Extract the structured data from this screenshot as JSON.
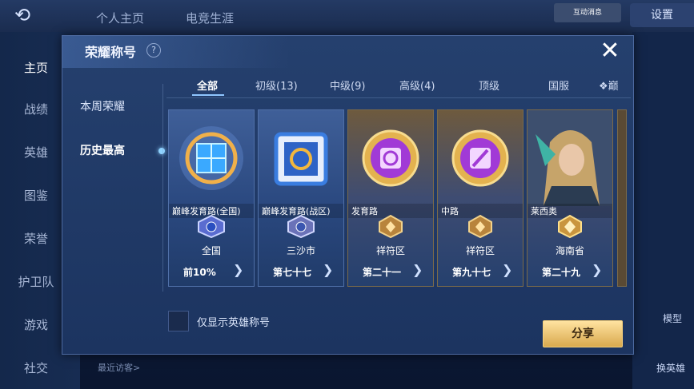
{
  "background": {
    "top_tabs": [
      "个人主页",
      "电竞生涯"
    ],
    "settings_label": "设置",
    "badge_text": "互动消息",
    "nav": [
      "主页",
      "战绩",
      "英雄",
      "图鉴",
      "荣誉",
      "护卫队",
      "游戏",
      "社交"
    ],
    "bottom_text": "最近访客>",
    "right_labels": [
      "模型",
      "换英雄"
    ]
  },
  "dialog": {
    "title": "荣耀称号",
    "help": "?",
    "close": "✕",
    "side_tabs": [
      "本周荣耀",
      "历史最高"
    ],
    "active_side_tab": "历史最高",
    "filter_tabs": [
      "全部",
      "初级(13)",
      "中级(9)",
      "高级(4)",
      "顶级",
      "国服",
      "巅"
    ],
    "active_filter": "全部",
    "cards": [
      {
        "name": "巅峰发育路(全国)",
        "region": "全国",
        "rank": "前10%",
        "art": "blue-cube-emblem-icon",
        "tier": "silver"
      },
      {
        "name": "巅峰发育路(战区)",
        "region": "三沙市",
        "rank": "第七十七",
        "art": "blue-square-emblem-icon",
        "tier": "silver"
      },
      {
        "name": "发育路",
        "region": "祥符区",
        "rank": "第二十一",
        "art": "purple-lane-emblem-icon",
        "tier": "gold"
      },
      {
        "name": "中路",
        "region": "祥符区",
        "rank": "第九十七",
        "art": "purple-mid-emblem-icon",
        "tier": "gold"
      },
      {
        "name": "莱西奥",
        "region": "海南省",
        "rank": "第二十九",
        "art": "hero-portrait-icon",
        "tier": "gold"
      }
    ],
    "checkbox_label": "仅显示英雄称号",
    "share_label": "分享"
  },
  "colors": {
    "accent": "#8fc6ff",
    "share_gold": "#d9a94e",
    "panel": "#1c3460"
  }
}
